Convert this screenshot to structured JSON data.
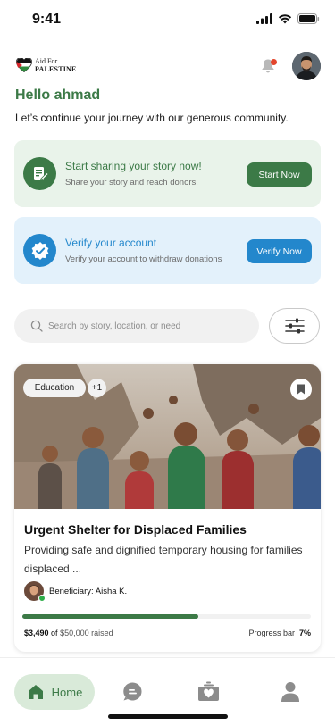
{
  "status_bar": {
    "time": "9:41"
  },
  "logo": {
    "line1": "Aid For",
    "line2": "PALESTINE"
  },
  "greeting": "Hello ahmad",
  "subtitle": "Let’s continue your journey with our generous community.",
  "cards": {
    "share": {
      "title": "Start sharing your story now!",
      "description": "Share your story and reach donors.",
      "button": "Start Now",
      "icon": "document-edit-icon"
    },
    "verify": {
      "title": "Verify your account",
      "description": "Verify your account to withdraw donations",
      "button": "Verify Now",
      "icon": "verified-badge-icon"
    }
  },
  "search": {
    "placeholder": "Search by story, location, or need"
  },
  "story": {
    "tags": [
      "Education",
      "+1"
    ],
    "title": "Urgent Shelter for Displaced Families",
    "description": "Providing safe and dignified temporary housing for families displaced  ...",
    "beneficiary": "Beneficiary: Aisha K.",
    "raised_amount": "$3,490",
    "raised_of": "of",
    "goal": "$50,000 raised",
    "progress_label": "Progress bar",
    "progress_percent": "7%",
    "progress_fill_fraction": 0.61
  },
  "nav": {
    "home": "Home",
    "items": [
      "home-icon",
      "chat-icon",
      "donation-box-icon",
      "profile-icon"
    ]
  },
  "colors": {
    "primary_green": "#3c7a47",
    "primary_blue": "#2387cc",
    "share_bg": "#e9f3ea",
    "verify_bg": "#e3f1fb",
    "notification_dot": "#e3452c"
  }
}
